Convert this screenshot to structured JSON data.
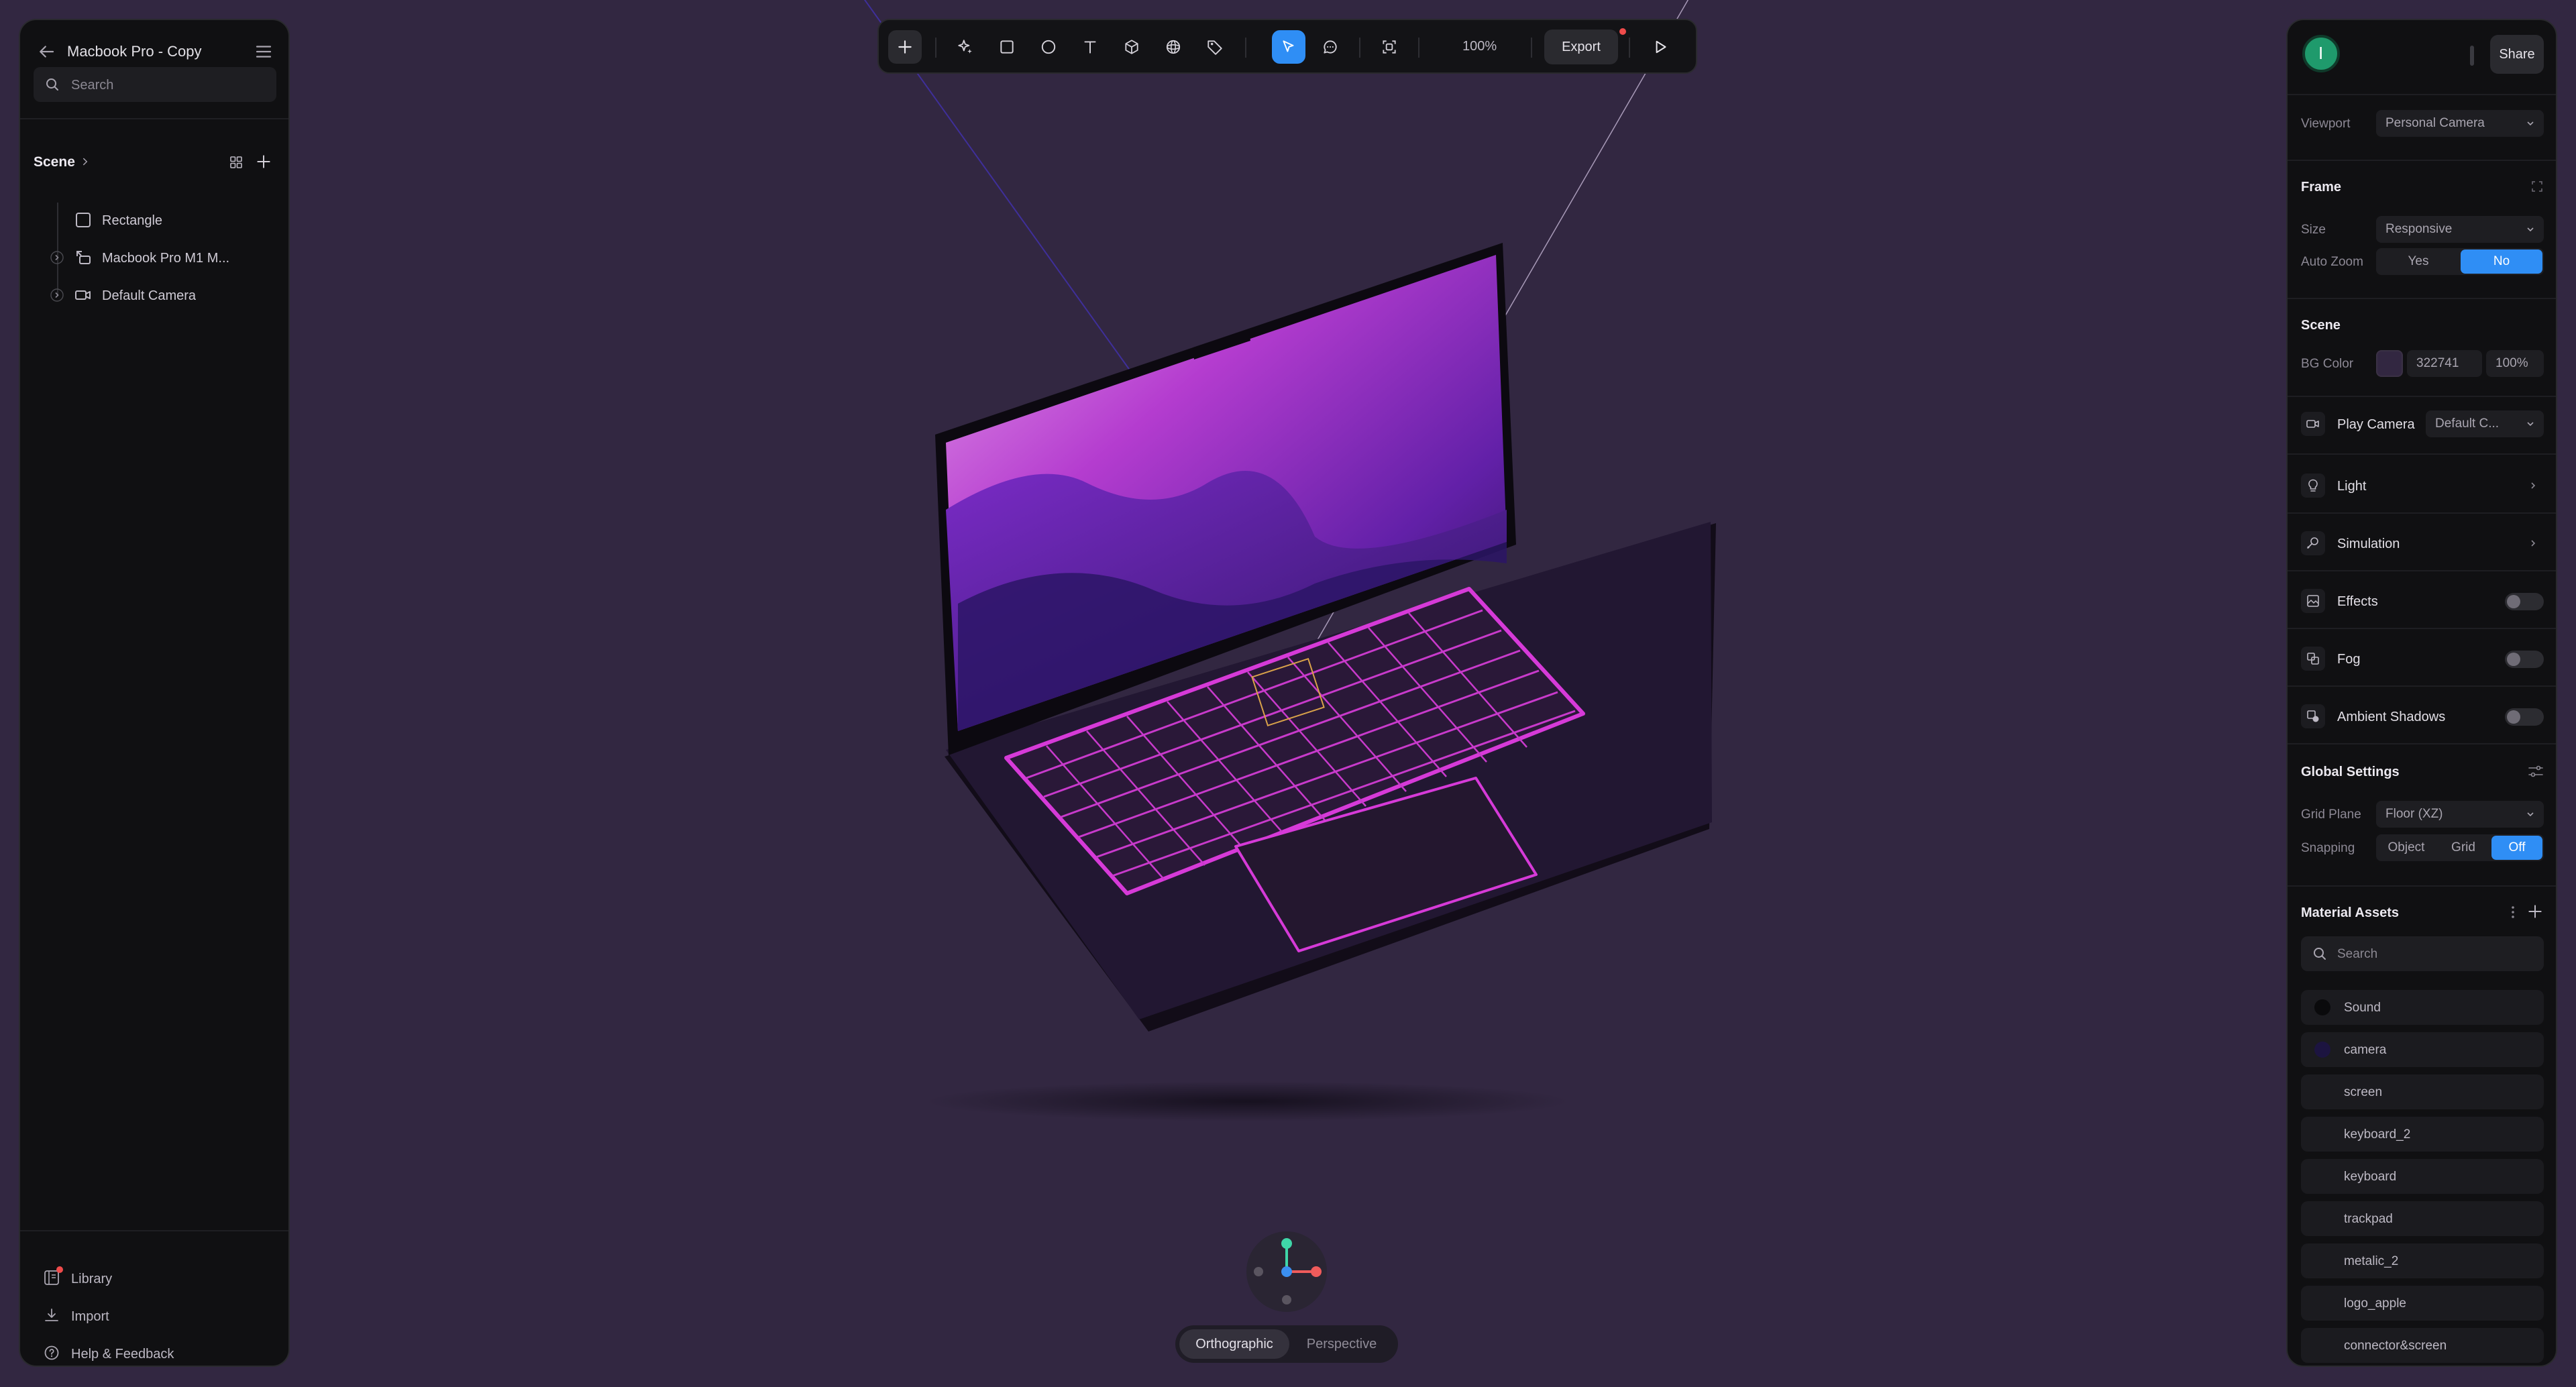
{
  "project": {
    "title": "Macbook Pro - Copy"
  },
  "left": {
    "search_placeholder": "Search",
    "scene_label": "Scene",
    "tree": [
      {
        "label": "Rectangle",
        "icon": "rectangle-icon"
      },
      {
        "label": "Macbook Pro M1 M...",
        "icon": "component-icon"
      },
      {
        "label": "Default Camera",
        "icon": "camera-icon"
      }
    ],
    "bottom": {
      "library": "Library",
      "import": "Import",
      "help": "Help & Feedback"
    }
  },
  "toolbar": {
    "tools": [
      "add",
      "ai-magic",
      "rectangle",
      "ellipse",
      "text",
      "cube",
      "sphere",
      "tag",
      "select",
      "comment",
      "screenshot"
    ],
    "active_tool": "select",
    "zoom": "100%",
    "export": "Export"
  },
  "viewport": {
    "projection_active": "Orthographic",
    "projection_inactive": "Perspective",
    "background": "#322741"
  },
  "right": {
    "avatar_initial": "I",
    "share": "Share",
    "viewport_label": "Viewport",
    "viewport_value": "Personal Camera",
    "frame": {
      "title": "Frame",
      "size_label": "Size",
      "size_value": "Responsive",
      "autozoom_label": "Auto Zoom",
      "yes": "Yes",
      "no": "No"
    },
    "scene": {
      "title": "Scene",
      "bg_label": "BG Color",
      "bg_hex": "322741",
      "bg_opacity": "100%"
    },
    "play_camera": {
      "label": "Play Camera",
      "value": "Default C..."
    },
    "features": {
      "light": "Light",
      "simulation": "Simulation",
      "effects": "Effects",
      "fog": "Fog",
      "ambient_shadows": "Ambient Shadows"
    },
    "global": {
      "title": "Global Settings",
      "grid_label": "Grid Plane",
      "grid_value": "Floor (XZ)",
      "snapping_label": "Snapping",
      "snap_object": "Object",
      "snap_grid": "Grid",
      "snap_off": "Off"
    },
    "materials": {
      "title": "Material Assets",
      "search_placeholder": "Search",
      "items": [
        {
          "label": "Sound",
          "color": "#0a0a0c"
        },
        {
          "label": "camera",
          "color": "#1c1440"
        },
        {
          "label": "screen",
          "color": ""
        },
        {
          "label": "keyboard_2",
          "color": ""
        },
        {
          "label": "keyboard",
          "color": ""
        },
        {
          "label": "trackpad",
          "color": ""
        },
        {
          "label": "metalic_2",
          "color": ""
        },
        {
          "label": "logo_apple",
          "color": ""
        },
        {
          "label": "connector&screen",
          "color": ""
        }
      ]
    }
  },
  "colors": {
    "accent": "#2f8ef5",
    "panel": "#101012",
    "notification": "#ef4b4b",
    "keyboard_glow": "#d63ad8"
  }
}
